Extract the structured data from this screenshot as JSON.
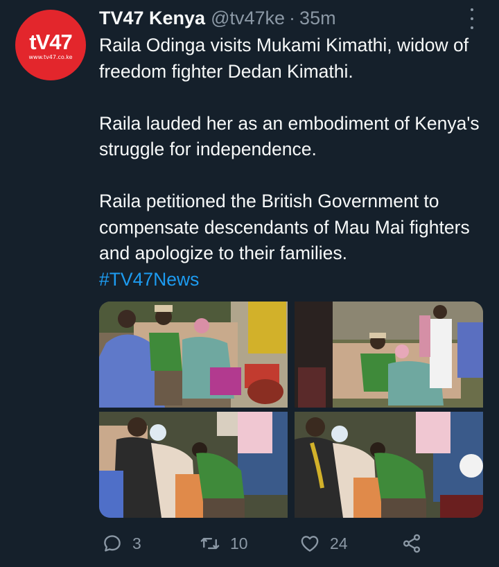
{
  "account": {
    "name": "TV47 Kenya",
    "handle": "@tv47ke",
    "separator": "·",
    "time": "35m",
    "avatar": {
      "logo_text": "tV47",
      "logo_url": "www.tv47.co.ke",
      "color": "#e3262c"
    }
  },
  "tweet": {
    "paragraphs": [
      "Raila Odinga visits Mukami Kimathi, widow of freedom fighter Dedan Kimathi.",
      "Raila lauded her as an embodiment of Kenya's struggle for independence.",
      "Raila petitioned the British Government to compensate descendants of Mau Mai fighters and apologize to their families."
    ],
    "hashtag": "#TV47News"
  },
  "actions": {
    "replies": "3",
    "retweets": "10",
    "likes": "24"
  },
  "icons": [
    "more-icon",
    "reply-icon",
    "retweet-icon",
    "like-icon",
    "share-icon"
  ],
  "colors": {
    "background": "#15202b",
    "text": "#f7f9f9",
    "muted": "#8b98a5",
    "link": "#1d9bf0"
  }
}
